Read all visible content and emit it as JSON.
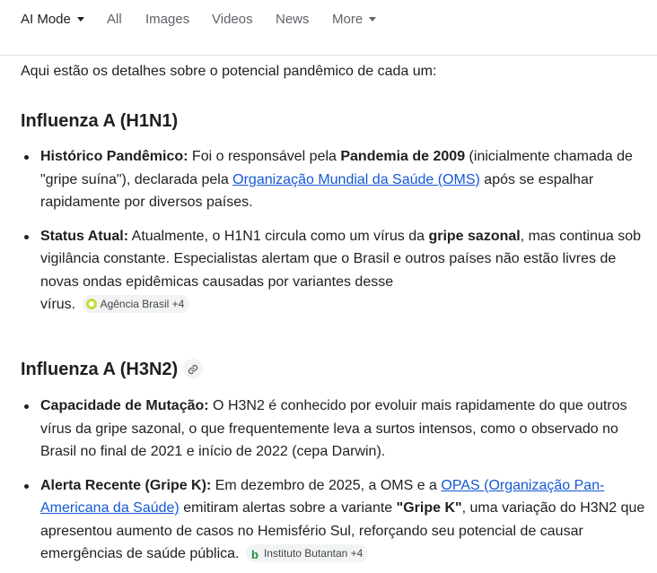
{
  "tabs": [
    {
      "label": "AI Mode",
      "active": true,
      "has_caret": true
    },
    {
      "label": "All"
    },
    {
      "label": "Images"
    },
    {
      "label": "Videos"
    },
    {
      "label": "News"
    },
    {
      "label": "More",
      "has_caret": true
    }
  ],
  "intro": "Aqui estão os detalhes sobre o potencial pandêmico de cada um:",
  "sections": [
    {
      "title": "Influenza A (H1N1)",
      "items": [
        {
          "label": "Histórico Pandêmico:",
          "t1": " Foi o responsável pela ",
          "b1": "Pandemia de 2009",
          "t2": " (inicialmente chamada de \"gripe suína\"), declarada pela ",
          "link": "Organização Mundial da Saúde (OMS)",
          "t3": " após se espalhar rapidamente por diversos países."
        },
        {
          "label": "Status Atual:",
          "t1": " Atualmente, o H1N1 circula como um vírus da ",
          "b1": "gripe sazonal",
          "t2": ", mas continua sob vigilância constante. Especialistas alertam que o Brasil e outros países não estão livres de novas ondas epidêmicas causadas por variantes desse",
          "t3": "vírus.",
          "chip": "Agência Brasil +4"
        }
      ]
    },
    {
      "title": "Influenza A (H3N2)",
      "link_icon": "link-icon",
      "items": [
        {
          "label": "Capacidade de Mutação:",
          "t1": " O H3N2 é conhecido por evoluir mais rapidamente do que outros vírus da gripe sazonal, o que frequentemente leva a surtos intensos, como o observado no Brasil no final de 2021 e início de 2022 (cepa Darwin)."
        },
        {
          "label": "Alerta Recente (Gripe K):",
          "t1": " Em dezembro de 2025, a OMS e a ",
          "link": "OPAS (Organização Pan-Americana da Saúde)",
          "t2": " emitiram alertas sobre a variante ",
          "b1": "\"Gripe K\"",
          "t3": ", uma variação do H3N2 que apresentou aumento de casos no Hemisfério Sul, reforçando seu potencial de causar emergências de saúde pública.",
          "chip": "Instituto Butantan +4"
        }
      ]
    }
  ],
  "colors": {
    "link": "#1558d6",
    "text": "#1f1f1f",
    "muted": "#5f6368",
    "chip_bg": "#f1f3f4"
  }
}
